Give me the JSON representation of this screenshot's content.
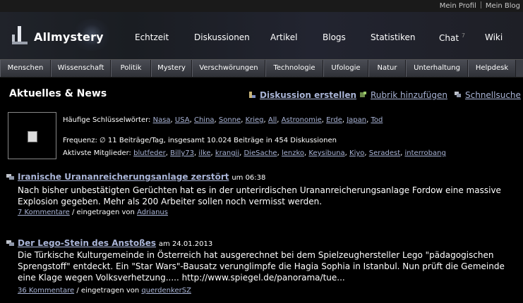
{
  "topbar": {
    "profile": "Mein Profil",
    "blog": "Mein Blog"
  },
  "logo": {
    "text": "Allmystery"
  },
  "nav": {
    "echtzeit": "Echtzeit",
    "diskussionen": "Diskussionen",
    "artikel": "Artikel",
    "blogs": "Blogs",
    "statistiken": "Statistiken",
    "chat": "Chat",
    "chat_count": "7",
    "wiki": "Wiki"
  },
  "categories": [
    "Menschen",
    "Wissenschaft",
    "Politik",
    "Mystery",
    "Verschwörungen",
    "Technologie",
    "Ufologie",
    "Natur",
    "Unterhaltung",
    "Helpdesk"
  ],
  "page": {
    "title": "Aktuelles & News",
    "create_discussion": "Diskussion erstellen",
    "add_rubric": "Rubrik hinzufügen",
    "quick_search": "Schnellsuche"
  },
  "keywords": {
    "label": "Häufige Schlüsselwörter:",
    "items": [
      "Nasa",
      "USA",
      "China",
      "Sonne",
      "Krieg",
      "All",
      "Astronomie",
      "Erde",
      "Japan",
      "Tod"
    ]
  },
  "frequency": {
    "text": "Frequenz: ∅ 11 Beiträge/Tag, insgesamt 10.024 Beiträge in 454 Diskussionen"
  },
  "members": {
    "label": "Aktivste Mitglieder:",
    "items": [
      "blutfeder",
      "Billy73",
      "ilke",
      "krangii",
      "DieSache",
      "lenzko",
      "Keysibuna",
      "Kiyo",
      "Seradest",
      "interrobang"
    ]
  },
  "articles": [
    {
      "title": "Iranische Urananreicherungsanlage zerstört",
      "date": "um 06:38",
      "text": "Nach bisher unbestätigten Gerüchten hat es in der unterirdischen Urananreicherungsanlage Fordow eine massive Explosion gegeben. Mehr als 200 Arbeiter sollen noch vermisst werden.",
      "comments": "7 Kommentare",
      "posted_by": "/ eingetragen von",
      "author": "Adrianus"
    },
    {
      "title": "Der Lego-Stein des Anstoßes",
      "date": "am 24.01.2013",
      "text": "Die Türkische Kulturgemeinde in Österreich hat ausgerechnet bei dem Spielzeughersteller Lego \"pädagogischen Sprengstoff\" entdeckt. Ein \"Star Wars\"-Bausatz verunglimpfe die Hagia Sophia in Istanbul. Nun prüft die Gemeinde eine Klage wegen Volksverhetzung..... http://www.spiegel.de/panorama/tue...",
      "comments": "36 Kommentare",
      "posted_by": "/ eingetragen von",
      "author": "querdenkerSZ"
    }
  ]
}
